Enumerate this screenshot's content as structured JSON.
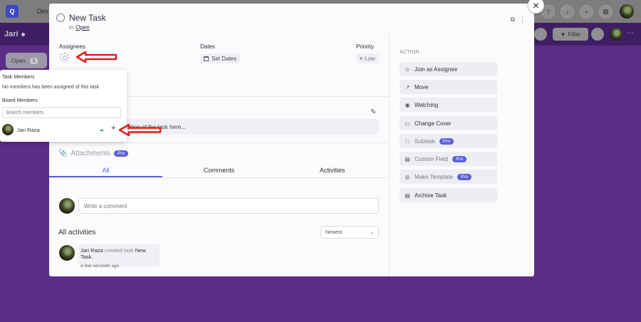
{
  "background": {
    "crumb": "Des",
    "board_name": "Jari",
    "filter_label": "Filter",
    "open_column": {
      "label": "Open",
      "count": "1"
    }
  },
  "task": {
    "title": "New Task",
    "in_label": "in",
    "status": "Open"
  },
  "fields": {
    "assignees_label": "Assignees",
    "dates_label": "Dates",
    "set_dates": "Set Dates",
    "priority_label": "Priority",
    "priority_value": "Low"
  },
  "description": {
    "placeholder_visible": "ription of the task here..."
  },
  "attachments": {
    "label": "Attachments",
    "badge": "Pro"
  },
  "tabs": [
    {
      "label": "All",
      "active": true
    },
    {
      "label": "Comments",
      "active": false
    },
    {
      "label": "Activities",
      "active": false
    }
  ],
  "comment": {
    "placeholder": "Write a comment"
  },
  "activities": {
    "title": "All activities",
    "sort": "Newest",
    "items": [
      {
        "user": "Jari Raza",
        "action": "created task",
        "target": "New Task.",
        "time": "a few seconds ago"
      }
    ]
  },
  "actions": {
    "label": "ACTION",
    "items": [
      {
        "label": "Join as Assignee",
        "icon": "user-icon",
        "pro": false
      },
      {
        "label": "Move",
        "icon": "arrow-up-right-icon",
        "pro": false
      },
      {
        "label": "Watching",
        "icon": "eye-icon",
        "pro": false
      },
      {
        "label": "Change Cover",
        "icon": "image-icon",
        "pro": false
      },
      {
        "label": "Subtask",
        "icon": "subtask-icon",
        "pro": true
      },
      {
        "label": "Custom Field",
        "icon": "list-icon",
        "pro": true
      },
      {
        "label": "Make Template",
        "icon": "template-icon",
        "pro": true
      },
      {
        "label": "Archive Task",
        "icon": "archive-icon",
        "pro": false
      }
    ],
    "pro_label": "Pro"
  },
  "members_popover": {
    "task_members_title": "Task Members",
    "no_members_text": "No members has been assigned of this task",
    "board_members_title": "Board Members",
    "search_placeholder": "Search members",
    "members": [
      {
        "name": "Jari Raza"
      }
    ]
  },
  "colors": {
    "accent": "#5b60d8",
    "annotation_arrow": "#e11d1d",
    "background": "#5c2d86"
  }
}
